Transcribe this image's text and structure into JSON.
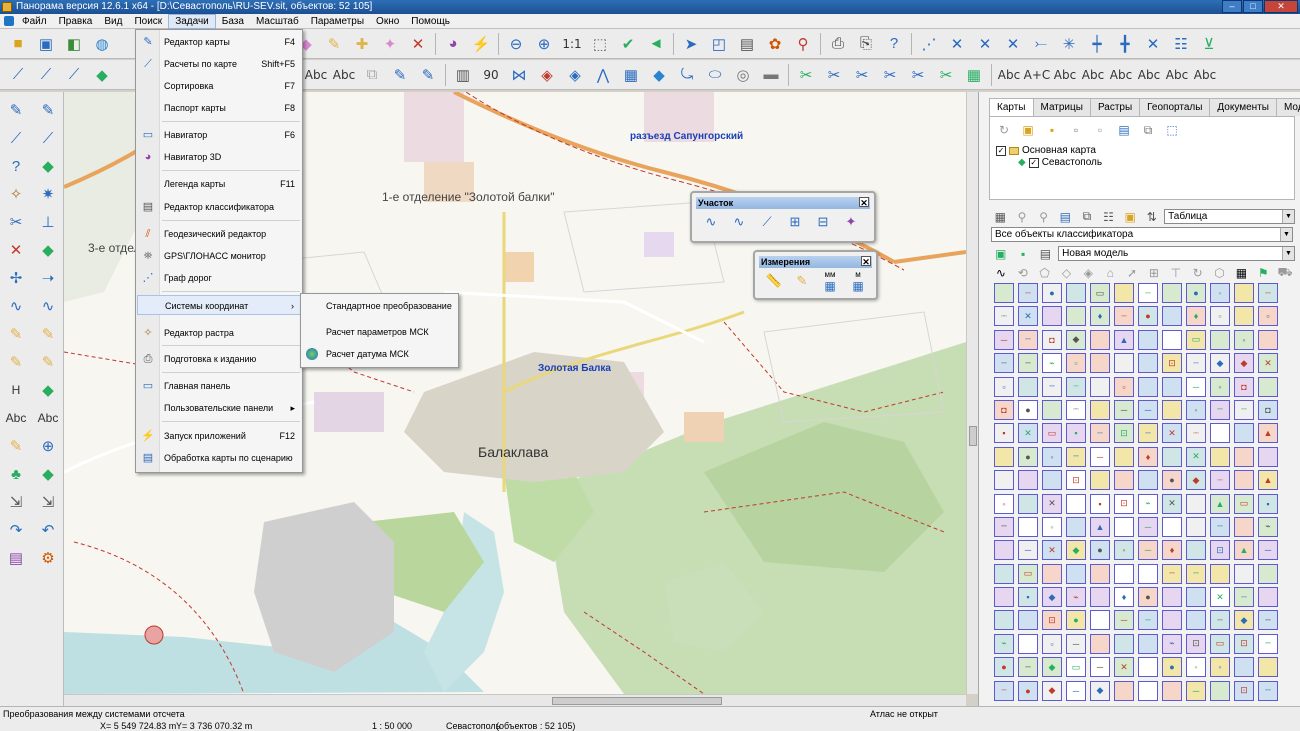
{
  "window": {
    "title": "Панорама версия 12.6.1 x64 - [D:\\Севастополь\\RU-SEV.sit, объектов: 52 105]",
    "buttons": {
      "minimize": "–",
      "maximize": "□",
      "close": "✕"
    }
  },
  "menubar": {
    "items": [
      "Файл",
      "Правка",
      "Вид",
      "Поиск",
      "Задачи",
      "База",
      "Масштаб",
      "Параметры",
      "Окно",
      "Помощь"
    ],
    "active": "Задачи"
  },
  "toolbar1": {
    "icons": [
      "open-folder-icon",
      "save-icon",
      "print-preview-icon",
      "globe-icon",
      "",
      "list-icon",
      "eraser-icon",
      "pencil-icon",
      "add-object-icon",
      "add-point-icon",
      "delete-icon",
      "palette-icon",
      "flash-icon",
      "zoom-out-icon",
      "zoom-in-icon",
      "",
      "fit-window-icon",
      "check-icon",
      "back-icon",
      "cursor-icon",
      "select-frame-icon",
      "text-select-icon",
      "paint-icon",
      "pin-icon",
      "print-icon",
      "print-setup-icon",
      "help-icon",
      "",
      "line-tool-1-icon",
      "line-tool-2-icon",
      "line-tool-3-icon",
      "line-tool-4-icon",
      "line-tool-5-icon",
      "line-tool-6-icon",
      "line-tool-7-icon",
      "line-tool-8-icon",
      "line-tool-9-icon",
      "line-tool-10-icon",
      "line-tool-11-icon"
    ],
    "scale_label": "1:1"
  },
  "toolbar2": {
    "text_tools": [
      "Abc",
      "Abc",
      "Abc",
      "A+C",
      "Abc",
      "Abc",
      "Abc",
      "Abc",
      "Abc",
      "Abc"
    ],
    "rotate_label": "90"
  },
  "left_tools": {
    "text_labels": [
      "H",
      "Abc",
      "Abc"
    ]
  },
  "menu_tasks": {
    "items": [
      {
        "label": "Редактор карты",
        "shortcut": "F4",
        "icon": "map-editor-icon"
      },
      {
        "label": "Расчеты по карте",
        "shortcut": "Shift+F5",
        "icon": "calc-icon"
      },
      {
        "label": "Сортировка",
        "shortcut": "F7",
        "icon": ""
      },
      {
        "label": "Паспорт карты",
        "shortcut": "F8",
        "icon": ""
      },
      {
        "label": "Навигатор",
        "shortcut": "F6",
        "icon": "navigator-icon"
      },
      {
        "label": "Навигатор 3D",
        "shortcut": "",
        "icon": "navigator-3d-icon"
      },
      {
        "label": "Легенда карты",
        "shortcut": "F11",
        "icon": ""
      },
      {
        "label": "Редактор классификатора",
        "shortcut": "",
        "icon": "classifier-icon"
      },
      {
        "label": "Геодезический редактор",
        "shortcut": "",
        "icon": "geodesy-icon"
      },
      {
        "label": "GPS\\ГЛОНАСС монитор",
        "shortcut": "",
        "icon": "gps-icon"
      },
      {
        "label": "Граф дорог",
        "shortcut": "",
        "icon": "graph-icon"
      },
      {
        "label": "Системы координат",
        "shortcut": "",
        "icon": "",
        "arrow": "›"
      },
      {
        "label": "Редактор растра",
        "shortcut": "",
        "icon": "raster-icon"
      },
      {
        "label": "Подготовка к изданию",
        "shortcut": "",
        "icon": "publish-icon"
      },
      {
        "label": "Главная панель",
        "shortcut": "",
        "icon": "main-panel-icon"
      },
      {
        "label": "Пользовательские панели",
        "shortcut": "",
        "icon": "",
        "arrow": "▸"
      },
      {
        "label": "Запуск приложений",
        "shortcut": "F12",
        "icon": "lightning-icon"
      },
      {
        "label": "Обработка карты по сценарию",
        "shortcut": "",
        "icon": "script-icon"
      }
    ]
  },
  "submenu_coords": {
    "items": [
      "Стандартное преобразование",
      "Расчет параметров МСК",
      "Расчет датума МСК"
    ]
  },
  "panel_uchastok": {
    "title": "Участок",
    "close": "✕"
  },
  "panel_izmereniya": {
    "title": "Измерения",
    "close": "✕",
    "mm_label": "мм",
    "m_label": "м"
  },
  "map": {
    "labels": {
      "razezd": "разъезд Сапунгорский",
      "otdelenie1": "1-е отделение \"Золотой балки\"",
      "otdelenie3": "3-е отдел",
      "zolotaya": "Золотая Балка",
      "balaklava": "Балаклава"
    }
  },
  "right_panel": {
    "tabs": [
      "Карты",
      "Матрицы",
      "Растры",
      "Геопорталы",
      "Документы",
      "Модели"
    ],
    "active_tab": "Карты",
    "tree": {
      "root": "Основная карта",
      "child": "Севастополь"
    },
    "view_select": "Таблица",
    "classifier_select": "Все объекты классификатора",
    "model_select": "Новая модель"
  },
  "statusbar": {
    "message": "Преобразования между системами отсчета",
    "atlas": "Атлас не открыт",
    "x": "X= 5 549 724.83 m",
    "y": "Y= 3 736 070.32 m",
    "scale": "1 : 50 000",
    "map": "Севастополь",
    "objects": "(объектов : 52 105)"
  },
  "colors": {
    "menu_highlight": "#e3ecf8",
    "palette_border": "#5e5ad0",
    "map_green": "#b8d8a0",
    "road_orange": "#e8a35c"
  }
}
